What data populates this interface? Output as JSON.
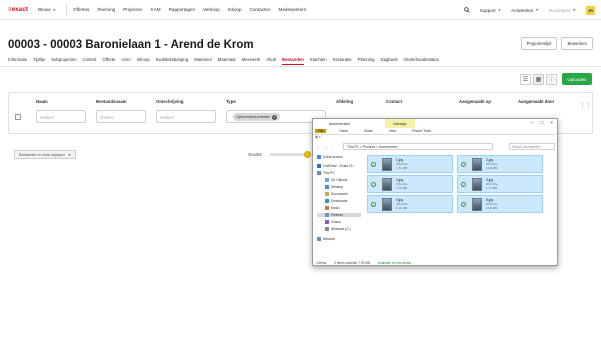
{
  "nav": {
    "logo": "exact",
    "environment": "Bloow",
    "items": [
      "Offertes",
      "Planning",
      "Projecten",
      "KAM",
      "Rapportages",
      "Verkoop",
      "Inkoop",
      "Contacten",
      "Medewerkers"
    ],
    "support": "Support",
    "activities": "Activiteiten",
    "user_name": "Roodzijers",
    "avatar_initials": "JR"
  },
  "page": {
    "title": "00003 - 00003 Baronielaan 1 - Arend de Krom",
    "project_list_button": "Projectenlijst",
    "edit_button": "Bewerken"
  },
  "tabs": [
    {
      "label": "Informatie",
      "active": false
    },
    {
      "label": "Tijdlijn",
      "active": false
    },
    {
      "label": "Subprojecten",
      "active": false
    },
    {
      "label": "Control",
      "active": false
    },
    {
      "label": "Offerte",
      "active": false
    },
    {
      "label": "Uren",
      "active": false
    },
    {
      "label": "Inkoop",
      "active": false
    },
    {
      "label": "Kwaliteitsborging",
      "active": false
    },
    {
      "label": "Materieel",
      "active": false
    },
    {
      "label": "Materiaal",
      "active": false
    },
    {
      "label": "Meerwerk",
      "active": false
    },
    {
      "label": "Afval",
      "active": false
    },
    {
      "label": "Bestanden",
      "active": true
    },
    {
      "label": "Klachten",
      "active": false
    },
    {
      "label": "Facturatie",
      "active": false
    },
    {
      "label": "Planning",
      "active": false
    },
    {
      "label": "Dagboek",
      "active": false
    },
    {
      "label": "Onderhoudsstatus",
      "active": false
    }
  ],
  "toolbar": {
    "upload_label": "Uploaden"
  },
  "grid": {
    "columns": {
      "name": "Naam",
      "filename": "Bestandsnaam",
      "description": "Omschrijving",
      "type": "Type",
      "department": "Afdeling",
      "contact": "Contact",
      "created_on": "Aangemaakt op",
      "created_by": "Aangemaakt door"
    },
    "search_placeholder": "Zoeken",
    "type_filter_chip": "Opleverdocumenten",
    "bulk_edit_label": "Bestanden in bulk wijzigen",
    "size_label": "Grootte"
  },
  "explorer": {
    "title": "documenten",
    "manage_tab": "Manage",
    "ribbon_tabs": [
      "File",
      "Home",
      "Share",
      "View",
      "Picture Tools"
    ],
    "path": "This PC  >  Pictures  >  documenten",
    "search_placeholder": "Search documenten",
    "sidebar": [
      {
        "label": "Quick access",
        "sub": false,
        "color": "#3b8fd9"
      },
      {
        "label": "OneDrive - Exact Gr...",
        "sub": false,
        "color": "#2a6fc9"
      },
      {
        "label": "This PC",
        "sub": false,
        "color": "#5a8fc0"
      },
      {
        "label": "3D Objects",
        "sub": true,
        "color": "#6aa8d8"
      },
      {
        "label": "Desktop",
        "sub": true,
        "color": "#3b8fd9"
      },
      {
        "label": "Documents",
        "sub": true,
        "color": "#c9a94a"
      },
      {
        "label": "Downloads",
        "sub": true,
        "color": "#3b8fd9"
      },
      {
        "label": "Music",
        "sub": true,
        "color": "#d07a3a"
      },
      {
        "label": "Pictures",
        "sub": true,
        "color": "#5a9ad8",
        "selected": true
      },
      {
        "label": "Videos",
        "sub": true,
        "color": "#7a5ad0"
      },
      {
        "label": "Windows (C:)",
        "sub": true,
        "color": "#888888"
      },
      {
        "label": "Network",
        "sub": false,
        "color": "#5a8fc0"
      }
    ],
    "files": [
      {
        "name": "1.jpg",
        "type": "JPG File",
        "size": "1,71 MB"
      },
      {
        "name": "2.jpg",
        "type": "JPG File",
        "size": "1,68 MB"
      },
      {
        "name": "3.jpg",
        "type": "JPG File",
        "size": "1,72 MB"
      },
      {
        "name": "4.jpg",
        "type": "JPG File",
        "size": "1,77 MB"
      },
      {
        "name": "5.jpg",
        "type": "JPG File",
        "size": "2,11 MB"
      },
      {
        "name": "6.jpg",
        "type": "JPG File",
        "size": "1,95 MB"
      }
    ],
    "status": {
      "items": "4 items",
      "selected": "4 items selected  7,09 MB",
      "availability": "Available on this device"
    }
  }
}
